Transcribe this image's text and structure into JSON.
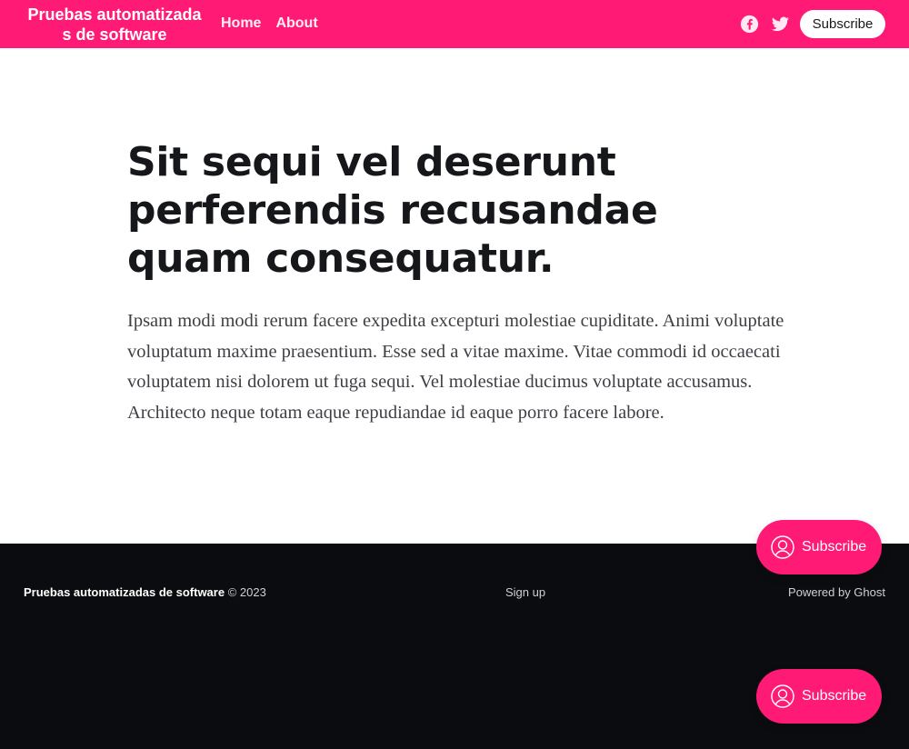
{
  "header": {
    "site_title": "Pruebas automatizadas de software",
    "nav": [
      {
        "label": "Home"
      },
      {
        "label": "About"
      }
    ],
    "social_icons": [
      "facebook-icon",
      "twitter-icon"
    ],
    "subscribe_label": "Subscribe",
    "accent_color": "#ff1a75"
  },
  "post": {
    "title": "Sit sequi vel deserunt perferendis recusandae quam consequatur.",
    "excerpt": "Ipsam modi modi rerum facere expedita excepturi molestiae cupiditate. Animi voluptate voluptatum maxime praesentium. Esse sed a vitae maxime. Vitae commodi id occaecati voluptatem nisi dolorem ut fuga sequi. Vel molestiae ducimus voluptate accusamus. Architecto neque totam eaque repudiandae id eaque porro facere labore."
  },
  "footer": {
    "site_name": "Pruebas automatizadas de software",
    "copyright": "© 2023",
    "signup_label": "Sign up",
    "powered_by": "Powered by Ghost",
    "background_color": "#0b0c0f"
  },
  "portal": {
    "button_label": "Subscribe",
    "icon": "user-circle-icon"
  }
}
